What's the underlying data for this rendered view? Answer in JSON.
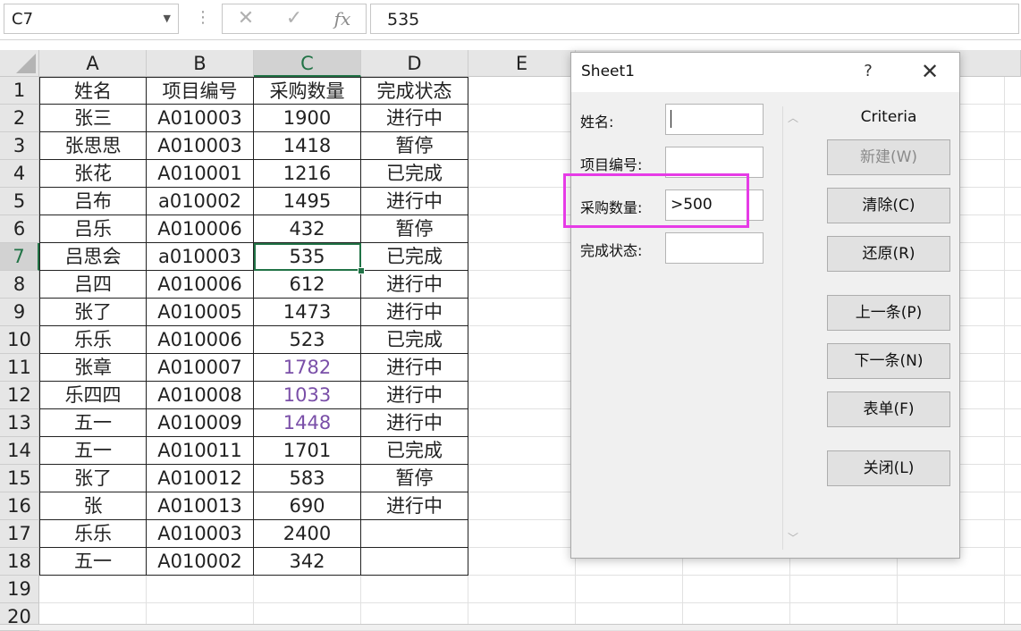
{
  "formula_bar": {
    "name_box": "C7",
    "cancel_symbol": "✕",
    "enter_symbol": "✓",
    "fx_label": "fx",
    "formula_value": "535"
  },
  "columns": [
    "A",
    "B",
    "C",
    "D",
    "E"
  ],
  "row_numbers": [
    "1",
    "2",
    "3",
    "4",
    "5",
    "6",
    "7",
    "8",
    "9",
    "10",
    "11",
    "12",
    "13",
    "14",
    "15",
    "16",
    "17",
    "18",
    "19",
    "20"
  ],
  "table": {
    "headers": [
      "姓名",
      "项目编号",
      "采购数量",
      "完成状态"
    ],
    "rows": [
      [
        "张三",
        "A010003",
        "1900",
        "进行中"
      ],
      [
        "张思思",
        "A010003",
        "1418",
        "暂停"
      ],
      [
        "张花",
        "A010001",
        "1216",
        "已完成"
      ],
      [
        "吕布",
        "a010002",
        "1495",
        "进行中"
      ],
      [
        "吕乐",
        "A010006",
        "432",
        "暂停"
      ],
      [
        "吕思会",
        "a010003",
        "535",
        "已完成"
      ],
      [
        "吕四",
        "A010006",
        "612",
        "进行中"
      ],
      [
        "张了",
        "A010005",
        "1473",
        "进行中"
      ],
      [
        "乐乐",
        "A010006",
        "523",
        "已完成"
      ],
      [
        "张章",
        "A010007",
        "1782",
        "进行中"
      ],
      [
        "乐四四",
        "A010008",
        "1033",
        "进行中"
      ],
      [
        "五一",
        "A010009",
        "1448",
        "进行中"
      ],
      [
        "五一",
        "A010011",
        "1701",
        "已完成"
      ],
      [
        "张了",
        "A010012",
        "583",
        "暂停"
      ],
      [
        "张",
        "A010013",
        "690",
        "进行中"
      ],
      [
        "乐乐",
        "A010003",
        "2400",
        ""
      ],
      [
        "五一",
        "A010002",
        "342",
        ""
      ]
    ],
    "purple_text_color": "#7a4fa8",
    "selection_color": "#217346"
  },
  "dialog": {
    "title": "Sheet1",
    "help_symbol": "?",
    "close_symbol": "✕",
    "fields": [
      {
        "label": "姓名:",
        "value": ""
      },
      {
        "label": "项目编号:",
        "value": ""
      },
      {
        "label": "采购数量:",
        "value": ">500"
      },
      {
        "label": "完成状态:",
        "value": ""
      }
    ],
    "criteria_label": "Criteria",
    "buttons": {
      "new": "新建(W)",
      "clear": "清除(C)",
      "restore": "还原(R)",
      "prev": "上一条(P)",
      "next": "下一条(N)",
      "form": "表单(F)",
      "close": "关闭(L)"
    },
    "highlight_color": "#e63be6"
  }
}
